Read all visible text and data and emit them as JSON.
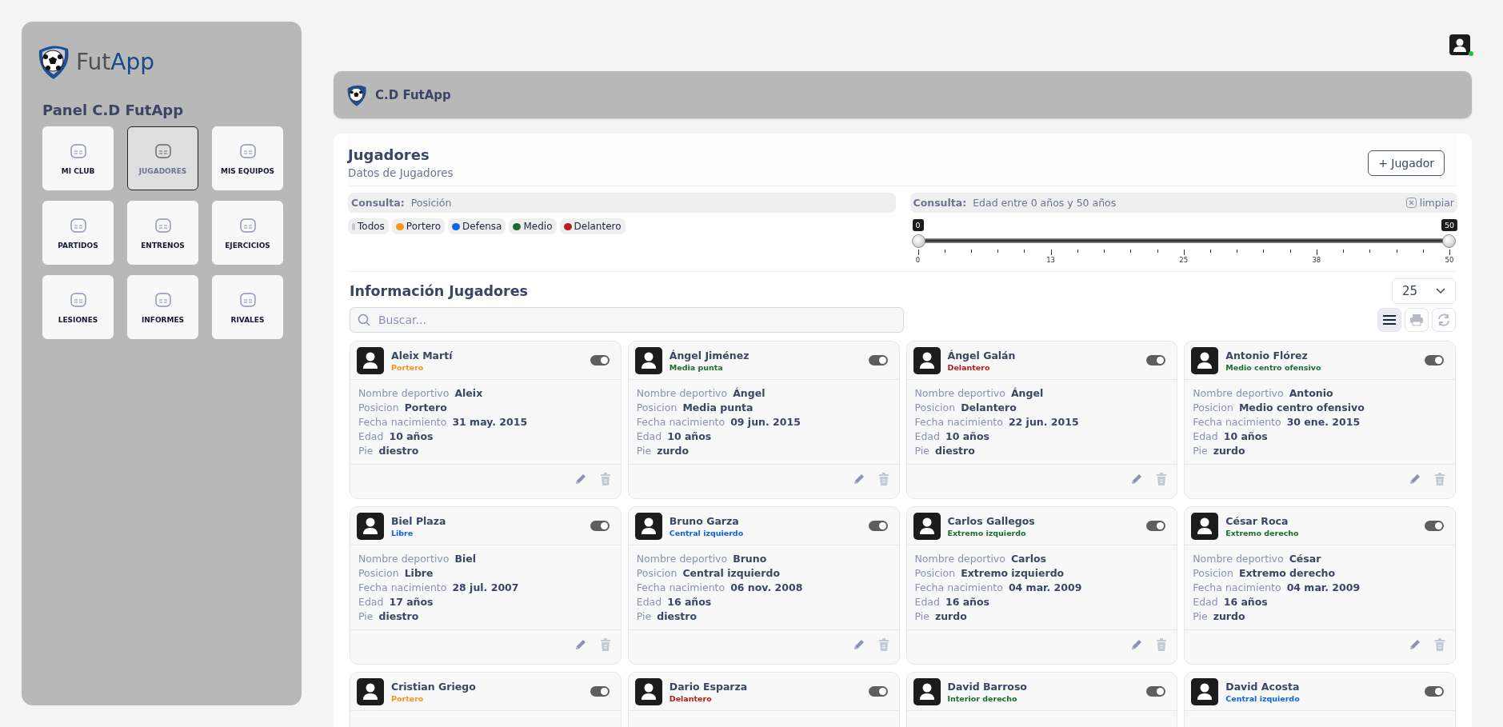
{
  "logo": {
    "text_parts": [
      "Fut",
      "App"
    ]
  },
  "sidebar": {
    "title": "Panel C.D FutApp",
    "items": [
      {
        "label": "MI CLUB",
        "selected": false
      },
      {
        "label": "JUGADORES",
        "selected": true
      },
      {
        "label": "MIS EQUIPOS",
        "selected": false
      },
      {
        "label": "PARTIDOS",
        "selected": false
      },
      {
        "label": "ENTRENOS",
        "selected": false
      },
      {
        "label": "EJERCICIOS",
        "selected": false
      },
      {
        "label": "LESIONES",
        "selected": false
      },
      {
        "label": "INFORMES",
        "selected": false
      },
      {
        "label": "RIVALES",
        "selected": false
      }
    ]
  },
  "user": {
    "online": true
  },
  "club_bar": {
    "title": "C.D FutApp"
  },
  "section": {
    "title": "Jugadores",
    "subtitle": "Datos de Jugadores",
    "add_button": "+ Jugador"
  },
  "position_filter": {
    "label": "Consulta:",
    "value": "Posición",
    "chips": [
      {
        "label": "Todos",
        "color": "#c3c8d6"
      },
      {
        "label": "Portero",
        "color": "#f7961e"
      },
      {
        "label": "Defensa",
        "color": "#0d63e8"
      },
      {
        "label": "Medio",
        "color": "#1e6b2e"
      },
      {
        "label": "Delantero",
        "color": "#b71c1c"
      }
    ]
  },
  "age_filter": {
    "label": "Consulta:",
    "value": "Edad entre 0 años y 50 años",
    "clear": "limpiar",
    "thumbs": [
      {
        "label": "0",
        "level": 0
      },
      {
        "label": "50",
        "level": 1
      }
    ],
    "tick_labels": [
      "0",
      "13",
      "25",
      "38",
      "50"
    ]
  },
  "list": {
    "title": "Información Jugadores",
    "page_size": "25",
    "search_placeholder": "Buscar...",
    "view_buttons": [
      {
        "kind": "list",
        "selected": true
      },
      {
        "kind": "print",
        "selected": false
      },
      {
        "kind": "refresh",
        "selected": false
      }
    ]
  },
  "players": [
    {
      "name": "Aleix Martí",
      "position": "Portero",
      "color": "#f7961e",
      "on": true,
      "fields": [
        {
          "label": "Nombre deportivo",
          "value": "Aleix"
        },
        {
          "label": "Posicion",
          "value": "Portero"
        },
        {
          "label": "Fecha nacimiento",
          "value": "31 may. 2015"
        },
        {
          "label": "Edad",
          "value": "10 años"
        },
        {
          "label": "Pie",
          "value": "diestro"
        }
      ]
    },
    {
      "name": "Ángel Jiménez",
      "position": "Media punta",
      "color": "#1e6b2e",
      "on": true,
      "fields": [
        {
          "label": "Nombre deportivo",
          "value": "Ángel"
        },
        {
          "label": "Posicion",
          "value": "Media punta"
        },
        {
          "label": "Fecha nacimiento",
          "value": "09 jun. 2015"
        },
        {
          "label": "Edad",
          "value": "10 años"
        },
        {
          "label": "Pie",
          "value": "zurdo"
        }
      ]
    },
    {
      "name": "Ángel Galán",
      "position": "Delantero",
      "color": "#b71c1c",
      "on": true,
      "fields": [
        {
          "label": "Nombre deportivo",
          "value": "Ángel"
        },
        {
          "label": "Posicion",
          "value": "Delantero"
        },
        {
          "label": "Fecha nacimiento",
          "value": "22 jun. 2015"
        },
        {
          "label": "Edad",
          "value": "10 años"
        },
        {
          "label": "Pie",
          "value": "diestro"
        }
      ]
    },
    {
      "name": "Antonio Flórez",
      "position": "Medio centro ofensivo",
      "color": "#1e6b2e",
      "on": true,
      "fields": [
        {
          "label": "Nombre deportivo",
          "value": "Antonio"
        },
        {
          "label": "Posicion",
          "value": "Medio centro ofensivo"
        },
        {
          "label": "Fecha nacimiento",
          "value": "30 ene. 2015"
        },
        {
          "label": "Edad",
          "value": "10 años"
        },
        {
          "label": "Pie",
          "value": "zurdo"
        }
      ]
    },
    {
      "name": "Biel Plaza",
      "position": "Libre",
      "color": "#0d63e8",
      "on": true,
      "fields": [
        {
          "label": "Nombre deportivo",
          "value": "Biel"
        },
        {
          "label": "Posicion",
          "value": "Libre"
        },
        {
          "label": "Fecha nacimiento",
          "value": "28 jul. 2007"
        },
        {
          "label": "Edad",
          "value": "17 años"
        },
        {
          "label": "Pie",
          "value": "diestro"
        }
      ]
    },
    {
      "name": "Bruno Garza",
      "position": "Central izquierdo",
      "color": "#0d63e8",
      "on": true,
      "fields": [
        {
          "label": "Nombre deportivo",
          "value": "Bruno"
        },
        {
          "label": "Posicion",
          "value": "Central izquierdo"
        },
        {
          "label": "Fecha nacimiento",
          "value": "06 nov. 2008"
        },
        {
          "label": "Edad",
          "value": "16 años"
        },
        {
          "label": "Pie",
          "value": "diestro"
        }
      ]
    },
    {
      "name": "Carlos Gallegos",
      "position": "Extremo izquierdo",
      "color": "#1e6b2e",
      "on": true,
      "fields": [
        {
          "label": "Nombre deportivo",
          "value": "Carlos"
        },
        {
          "label": "Posicion",
          "value": "Extremo izquierdo"
        },
        {
          "label": "Fecha nacimiento",
          "value": "04 mar. 2009"
        },
        {
          "label": "Edad",
          "value": "16 años"
        },
        {
          "label": "Pie",
          "value": "zurdo"
        }
      ]
    },
    {
      "name": "César Roca",
      "position": "Extremo derecho",
      "color": "#1e6b2e",
      "on": true,
      "fields": [
        {
          "label": "Nombre deportivo",
          "value": "César"
        },
        {
          "label": "Posicion",
          "value": "Extremo derecho"
        },
        {
          "label": "Fecha nacimiento",
          "value": "04 mar. 2009"
        },
        {
          "label": "Edad",
          "value": "16 años"
        },
        {
          "label": "Pie",
          "value": "zurdo"
        }
      ]
    },
    {
      "name": "Cristian Griego",
      "position": "Portero",
      "color": "#f7961e",
      "on": true
    },
    {
      "name": "Dario Esparza",
      "position": "Delantero",
      "color": "#b71c1c",
      "on": true
    },
    {
      "name": "David Barroso",
      "position": "Interior derecho",
      "color": "#1e6b2e",
      "on": true
    },
    {
      "name": "David Acosta",
      "position": "Central izquierdo",
      "color": "#0d63e8",
      "on": true
    }
  ]
}
